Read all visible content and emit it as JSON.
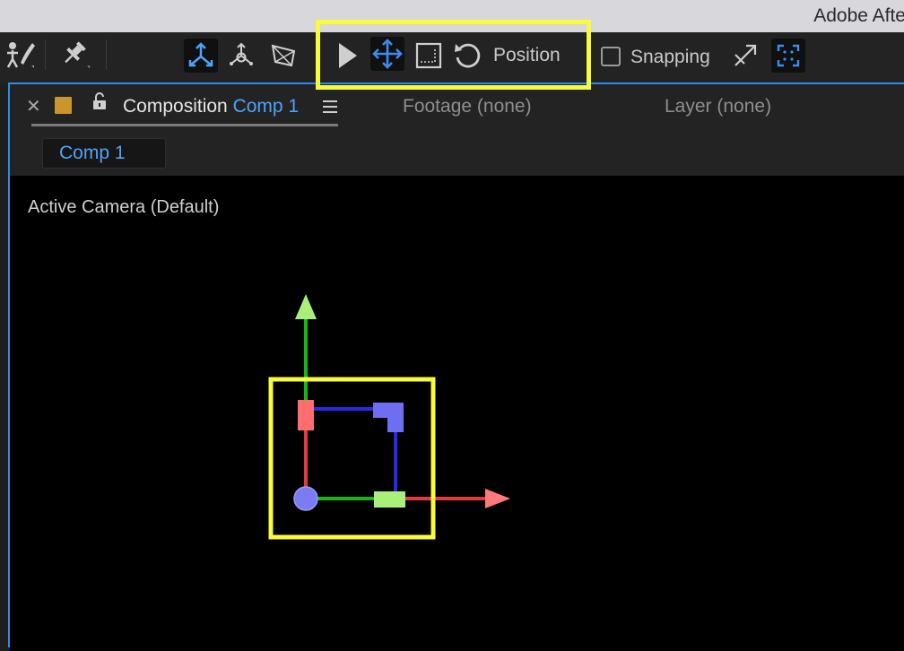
{
  "window": {
    "app_title": "Adobe Afte"
  },
  "toolbar": {
    "tools": [
      {
        "name": "puppet-tool",
        "active": false
      },
      {
        "name": "pin-tool",
        "active": false
      },
      {
        "name": "local-axis-mode",
        "active": true
      },
      {
        "name": "world-axis-mode",
        "active": false
      },
      {
        "name": "view-axis-mode",
        "active": false
      },
      {
        "name": "selection-tool",
        "active": false
      },
      {
        "name": "move-tool",
        "active": true
      },
      {
        "name": "scale-tool",
        "active": false
      },
      {
        "name": "rotate-tool",
        "active": false
      }
    ],
    "transform_mode_label": "Position",
    "snapping_label": "Snapping",
    "snapping_checked": false
  },
  "panel": {
    "tabs": {
      "composition_label": "Composition",
      "composition_name": "Comp 1",
      "footage_label": "Footage (none)",
      "layer_label": "Layer (none)"
    },
    "breadcrumb": "Comp 1",
    "viewer": {
      "camera_label": "Active Camera (Default)"
    }
  },
  "colors": {
    "accent_blue": "#4fa3f7",
    "highlight_yellow": "#fafa3c",
    "axis_x": "#e23b3b",
    "axis_y": "#16b816",
    "axis_z": "#2a2ae6",
    "comp_swatch": "#c8962a"
  }
}
